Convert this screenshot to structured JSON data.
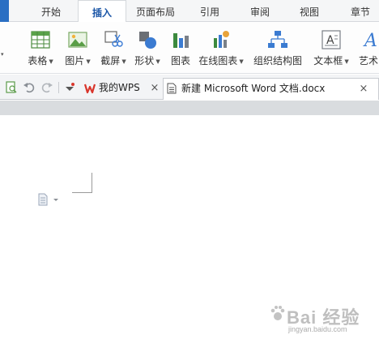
{
  "menu": {
    "tabs": [
      {
        "label": "开始"
      },
      {
        "label": "插入",
        "active": true
      },
      {
        "label": "页面布局"
      },
      {
        "label": "引用"
      },
      {
        "label": "审阅"
      },
      {
        "label": "视图"
      },
      {
        "label": "章节"
      }
    ]
  },
  "ribbon": {
    "buttons": [
      {
        "label": "表格",
        "icon": "table-icon",
        "dropdown": true
      },
      {
        "label": "图片",
        "icon": "picture-icon",
        "dropdown": true
      },
      {
        "label": "截屏",
        "icon": "screenshot-icon",
        "dropdown": true
      },
      {
        "label": "形状",
        "icon": "shapes-icon",
        "dropdown": true
      },
      {
        "label": "图表",
        "icon": "chart-icon",
        "dropdown": false
      },
      {
        "label": "在线图表",
        "icon": "online-chart-icon",
        "dropdown": true
      },
      {
        "label": "组织结构图",
        "icon": "org-chart-icon",
        "dropdown": false
      },
      {
        "label": "文本框",
        "icon": "textbox-icon",
        "dropdown": true
      },
      {
        "label": "艺术",
        "icon": "wordart-icon",
        "dropdown": false
      }
    ],
    "left_caret": "▾"
  },
  "doc_tabs": [
    {
      "label": "我的WPS",
      "icon": "wps-logo-icon",
      "close": "×"
    },
    {
      "label": "新建 Microsoft Word 文档.docx",
      "icon": "word-doc-icon",
      "close": "×",
      "active": true
    }
  ],
  "watermark": {
    "text": "Bai 经验",
    "sub": "jingyan.baidu.com"
  },
  "colors": {
    "accent": "#2b6fc3",
    "active_tab_text": "#1a55a6",
    "wps_red": "#d9352b"
  }
}
